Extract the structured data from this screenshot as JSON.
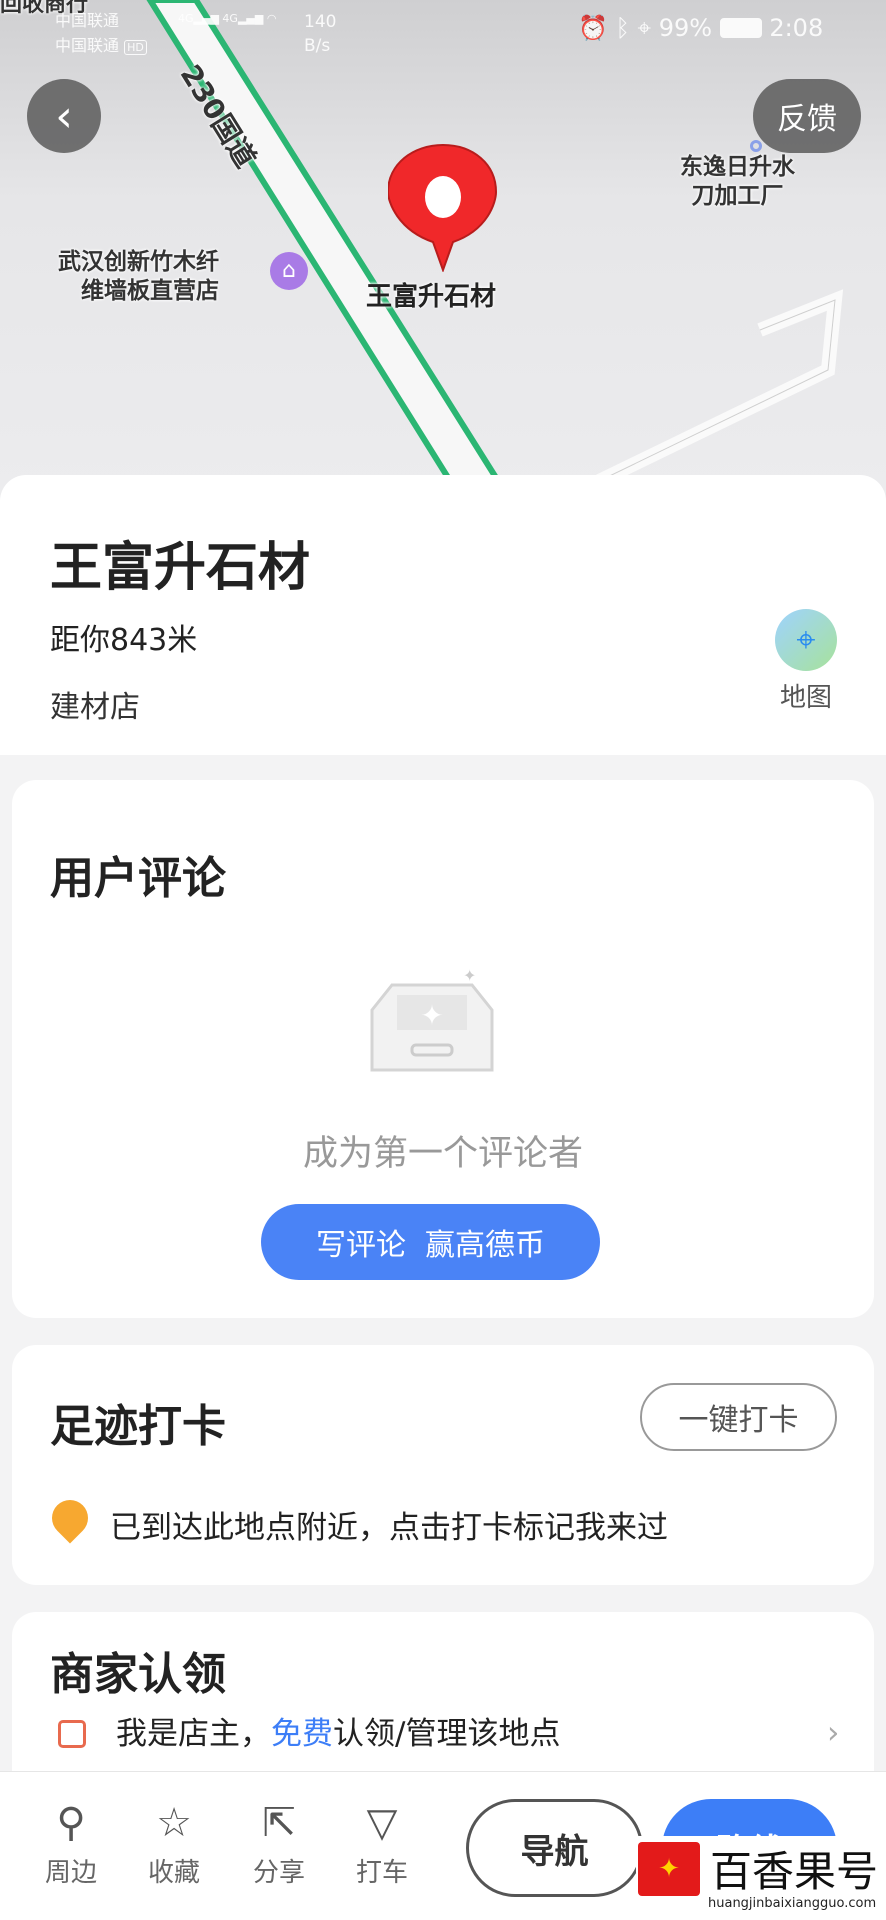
{
  "status_bar": {
    "carrier1": "中国联通",
    "carrier2": "中国联通",
    "hd": "HD",
    "net1": "4G",
    "net2": "4G",
    "speed_value": "140",
    "speed_unit": "B/s",
    "battery": "99%",
    "time": "2:08"
  },
  "map": {
    "road_label": "230国道",
    "top_label": "回收商行",
    "poi_left": [
      "武汉创新竹木纤",
      "维墙板直营店"
    ],
    "poi_right": [
      "东逸日升水",
      "刀加工厂"
    ],
    "pin_label": "王富升石材",
    "feedback": "反馈",
    "colors": {
      "road_border": "#2bb673",
      "pin": "#f0282a",
      "poi_shop": "#a97be6"
    }
  },
  "place": {
    "name": "王富升石材",
    "distance": "距你843米",
    "category": "建材店",
    "map_button": "地图"
  },
  "reviews": {
    "title": "用户评论",
    "empty_text": "成为第一个评论者",
    "button": "写评论  赢高德币"
  },
  "checkin": {
    "title": "足迹打卡",
    "button": "一键打卡",
    "hint": "已到达此地点附近，点击打卡标记我来过"
  },
  "merchant": {
    "title": "商家认领",
    "row_prefix": "我是店主，",
    "row_link": "免费",
    "row_suffix": "认领/管理该地点"
  },
  "bottom": {
    "tools": [
      {
        "label": "周边",
        "icon": "search-icon"
      },
      {
        "label": "收藏",
        "icon": "star-icon"
      },
      {
        "label": "分享",
        "icon": "share-icon"
      },
      {
        "label": "打车",
        "icon": "taxi-icon"
      }
    ],
    "navigate": "导航",
    "route": "路线",
    "accent": "#3d7ef7"
  },
  "watermark": {
    "name": "百香果号",
    "url": "huangjinbaixiangguo.com"
  }
}
